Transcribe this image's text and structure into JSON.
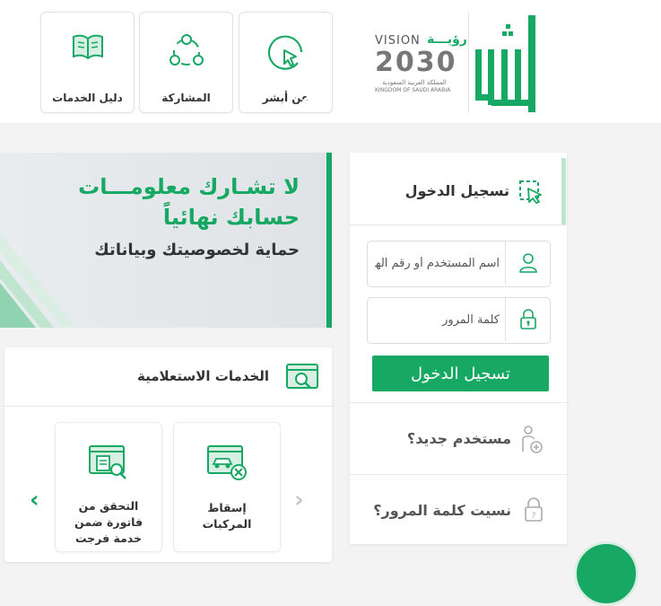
{
  "header": {
    "nav": [
      {
        "label": "دليل الخدمات",
        "icon": "book-icon"
      },
      {
        "label": "المشاركة",
        "icon": "share-network-icon"
      },
      {
        "label": "عن أبشر",
        "icon": "cursor-pointer-icon"
      }
    ],
    "vision": {
      "word": "VISION",
      "arabic": "رؤيـــة",
      "year": "2030",
      "country_ar": "المملكة العربية السعودية",
      "country_en": "KINGDOM OF SAUDI ARABIA"
    }
  },
  "banner": {
    "line1": "لا تشـارك معلومـــات",
    "line2": "حسابك نهائياً",
    "line3": "حماية لخصوصيتك وبياناتك"
  },
  "services": {
    "title": "الخدمات الاستعلامية",
    "cards": [
      {
        "label": "التحقق من فاتورة ضمن خدمة فرجت",
        "icon": "invoice-search-icon"
      },
      {
        "label": "إسقاط المركبات",
        "icon": "vehicle-drop-icon"
      }
    ]
  },
  "login": {
    "title": "تسجيل الدخول",
    "username_placeholder": "اسم المستخدم أو رقم الهوية",
    "password_placeholder": "كلمة المرور",
    "button_label": "تسجيل الدخول",
    "new_user_label": "مستخدم جديد؟",
    "forgot_label": "نسيت كلمة المرور؟"
  },
  "colors": {
    "brand_green": "#17a863"
  }
}
